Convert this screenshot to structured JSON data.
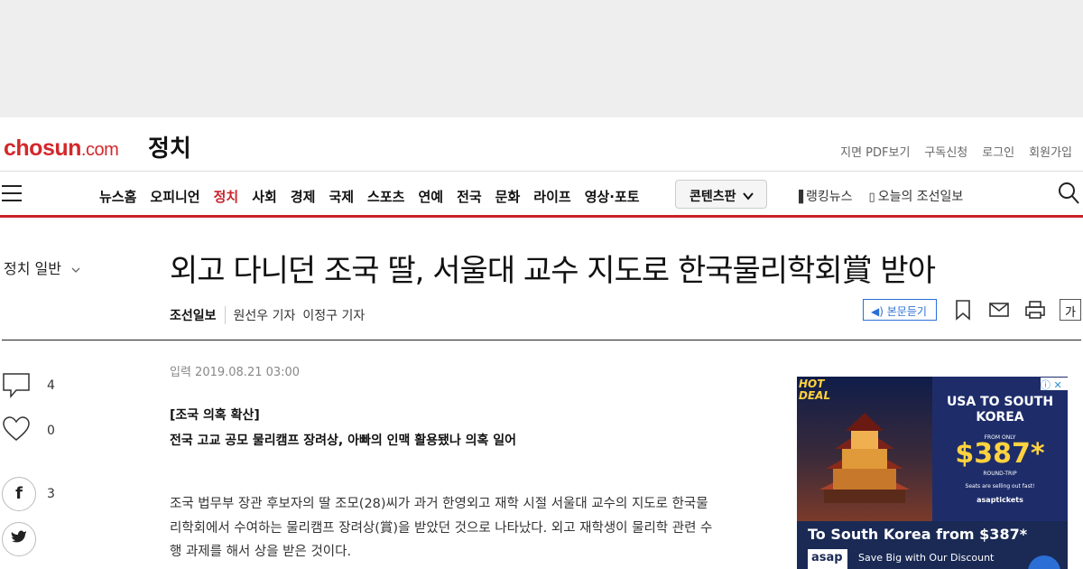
{
  "header": {
    "logo_main": "chosun",
    "logo_suffix": ".com",
    "section": "정치",
    "util_links": [
      "지면 PDF보기",
      "구독신청",
      "로그인",
      "회원가입"
    ]
  },
  "gnb": {
    "menu": [
      "뉴스홈",
      "오피니언",
      "정치",
      "사회",
      "경제",
      "국제",
      "스포츠",
      "연예",
      "전국",
      "문화",
      "라이프",
      "영상·포토"
    ],
    "active_index": 2,
    "content_button": "콘텐츠판",
    "ranking": "랭킹뉴스",
    "today": "오늘의 조선일보"
  },
  "article": {
    "category": "정치 일반",
    "headline": "외고 다니던 조국 딸, 서울대 교수 지도로 한국물리학회賞 받아",
    "press": "조선일보",
    "reporters": [
      "원선우 기자",
      "이정구 기자"
    ],
    "listen_label": "본문듣기",
    "font_label": "가",
    "date": "입력 2019.08.21 03:00",
    "summary_1": "[조국 의혹 확산]",
    "summary_2": "전국 고교 공모 물리캠프 장려상, 아빠의 인맥 활용됐나 의혹 일어",
    "body_lines": [
      "조국 법무부 장관 후보자의 딸 조모(28)씨가 과거 한영외고 재학 시절 서울대 교수의 지도로 한국물",
      "리학회에서 수여하는 물리캠프 장려상(賞)을 받았던 것으로 나타났다. 외고 재학생이 물리학 관련 수",
      "행 과제를 해서 상을 받은 것이다."
    ]
  },
  "social": {
    "comments": "4",
    "likes": "0",
    "facebook": "3"
  },
  "ad": {
    "badge_1": "HOT",
    "badge_2": "DEAL",
    "headline": "USA TO SOUTH KOREA",
    "from": "FROM ONLY",
    "price": "$387*",
    "round_trip": "ROUND-TRIP",
    "selling": "Seats are selling out fast!",
    "brand": "asaptickets",
    "title": "To South Korea from $387*",
    "logo": "asap",
    "desc": "Save Big with Our Discount"
  }
}
